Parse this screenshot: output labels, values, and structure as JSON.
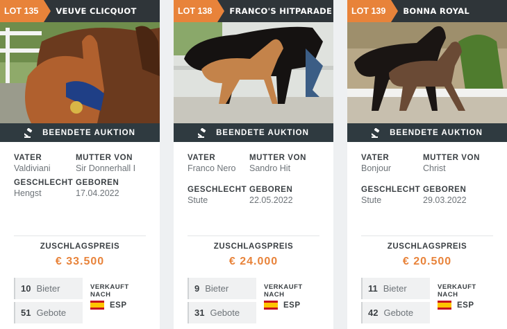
{
  "status_label": "BEENDETE AUKTION",
  "labels": {
    "vater": "VATER",
    "mutter_von": "MUTTER VON",
    "geschlecht": "GESCHLECHT",
    "geboren": "GEBOREN",
    "zuschlagspreis": "ZUSCHLAGSPREIS",
    "bieter": "Bieter",
    "gebote": "Gebote",
    "verkauft_nach": "VERKAUFT NACH"
  },
  "colors": {
    "accent": "#e8833a",
    "dark_bar": "#2f3539",
    "status_bar": "#2f3a40"
  },
  "lots": [
    {
      "lot": "LOT 135",
      "name": "VEUVE CLICQUOT",
      "vater": "Valdiviani",
      "mutter_von": "Sir Donnerhall I",
      "geschlecht": "Hengst",
      "geboren": "17.04.2022",
      "price": "€ 33.500",
      "bieter": "10",
      "gebote": "51",
      "country_code": "ESP",
      "flag_icon": "spain-flag-icon"
    },
    {
      "lot": "LOT 138",
      "name": "FRANCO'S HITPARADE",
      "vater": "Franco Nero",
      "mutter_von": "Sandro Hit",
      "geschlecht": "Stute",
      "geboren": "22.05.2022",
      "price": "€ 24.000",
      "bieter": "9",
      "gebote": "31",
      "country_code": "ESP",
      "flag_icon": "spain-flag-icon"
    },
    {
      "lot": "LOT 139",
      "name": "BONNA ROYAL",
      "vater": "Bonjour",
      "mutter_von": "Christ",
      "geschlecht": "Stute",
      "geboren": "29.03.2022",
      "price": "€ 20.500",
      "bieter": "11",
      "gebote": "42",
      "country_code": "ESP",
      "flag_icon": "spain-flag-icon"
    }
  ]
}
